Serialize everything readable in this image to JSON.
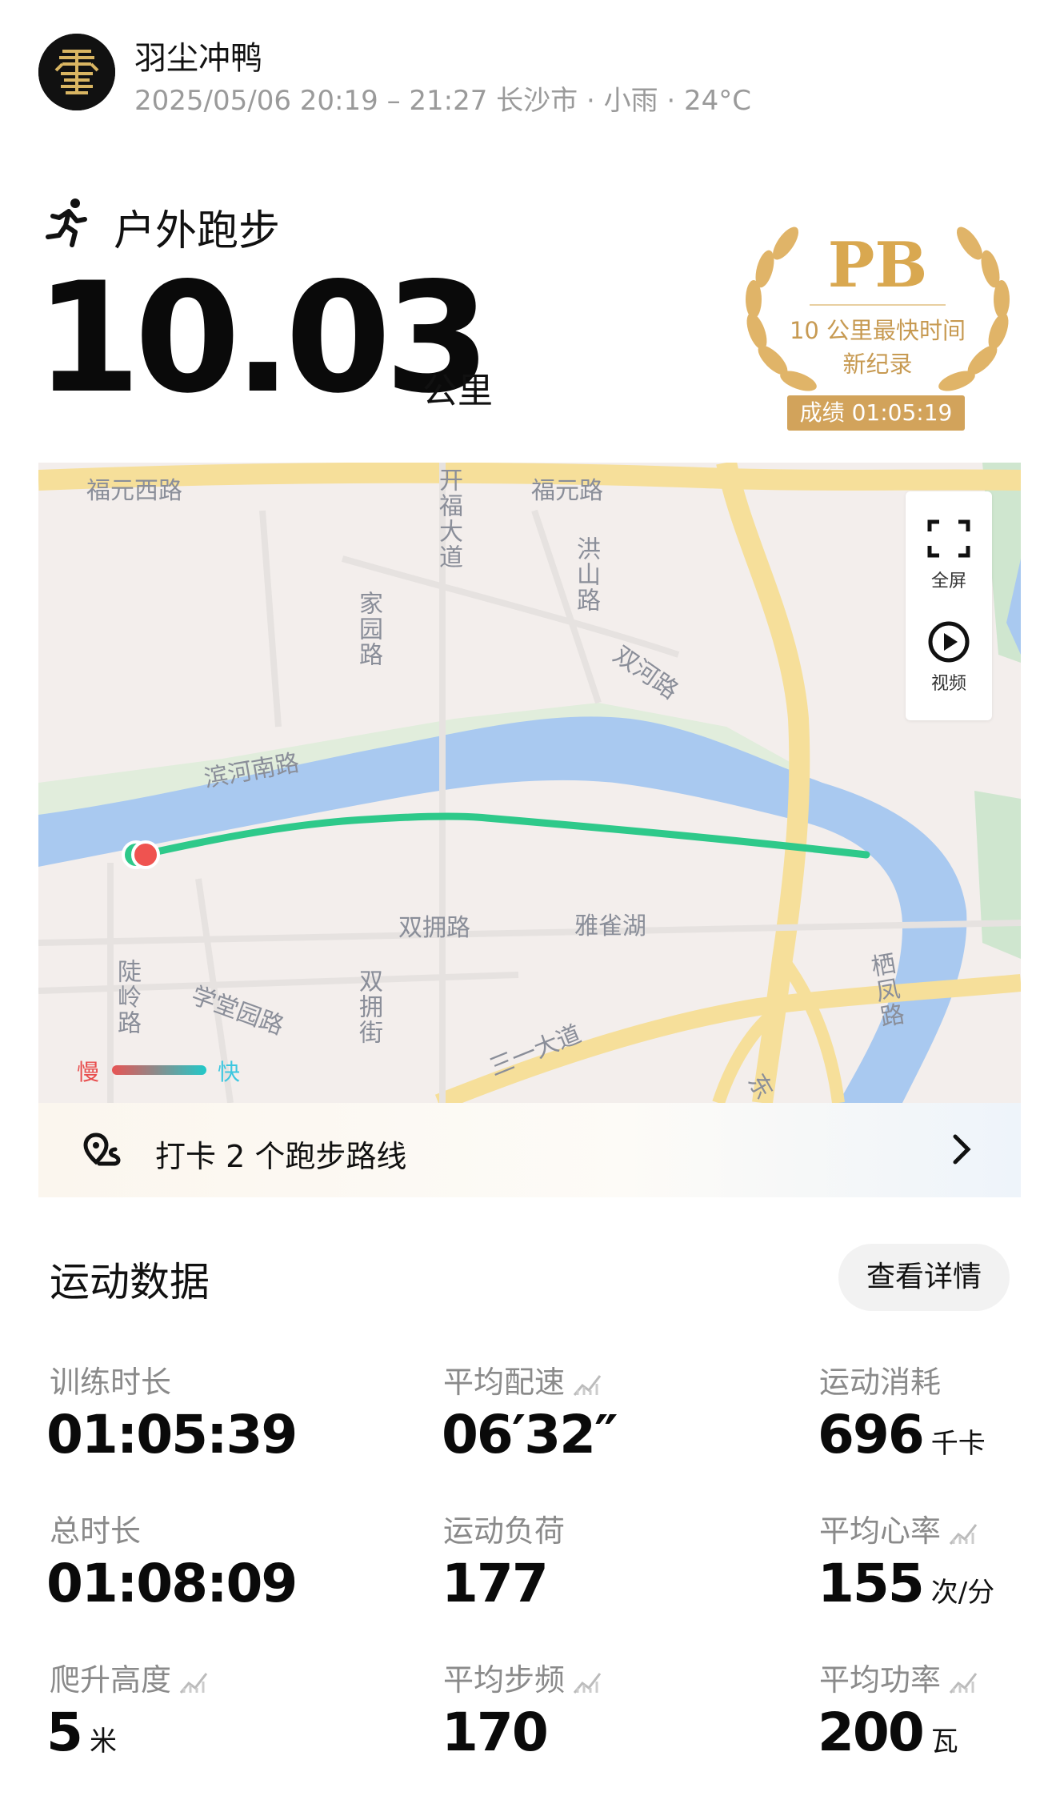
{
  "header": {
    "username": "羽尘冲鸭",
    "meta": "2025/05/06 20:19 – 21:27 长沙市 · 小雨 · 24°C"
  },
  "activity": {
    "type": "户外跑步",
    "distance": "10.03",
    "distance_unit": "公里"
  },
  "pb_badge": {
    "title": "PB",
    "line1": "10 公里最快时间",
    "line2": "新纪录",
    "result": "成绩 01:05:19",
    "color": "#d2a35b"
  },
  "map": {
    "labels": {
      "fuyuan_west": "福元西路",
      "fuyuan": "福元路",
      "kaifu": "开福大道",
      "hongshan": "洪山路",
      "jiayuan": "家园路",
      "shuanghe": "双河路",
      "binhe_south": "滨河南路",
      "shuangyong": "双拥路",
      "yaquehu": "雅雀湖",
      "luling": "陡岭路",
      "xuetangyuan": "学堂园路",
      "shuangyongjie": "双拥街",
      "sanyi": "三一大道",
      "qifeng": "栖凤路",
      "dong": "东"
    },
    "fullscreen_label": "全屏",
    "video_label": "视频",
    "legend_slow": "慢",
    "legend_fast": "快",
    "route_color": "#2ec98a",
    "river_color": "#a9c9f0"
  },
  "checkin": {
    "text": "打卡 2 个跑步路线"
  },
  "stats": {
    "section_title": "运动数据",
    "detail_button": "查看详情",
    "items": [
      {
        "label": "训练时长",
        "value": "01:05:39",
        "unit": ""
      },
      {
        "label": "平均配速",
        "value": "06′32″",
        "unit": ""
      },
      {
        "label": "运动消耗",
        "value": "696",
        "unit": "千卡"
      },
      {
        "label": "总时长",
        "value": "01:08:09",
        "unit": ""
      },
      {
        "label": "运动负荷",
        "value": "177",
        "unit": ""
      },
      {
        "label": "平均心率",
        "value": "155",
        "unit": "次/分"
      },
      {
        "label": "爬升高度",
        "value": "5",
        "unit": "米"
      },
      {
        "label": "平均步频",
        "value": "170",
        "unit": ""
      },
      {
        "label": "平均功率",
        "value": "200",
        "unit": "瓦"
      }
    ]
  }
}
